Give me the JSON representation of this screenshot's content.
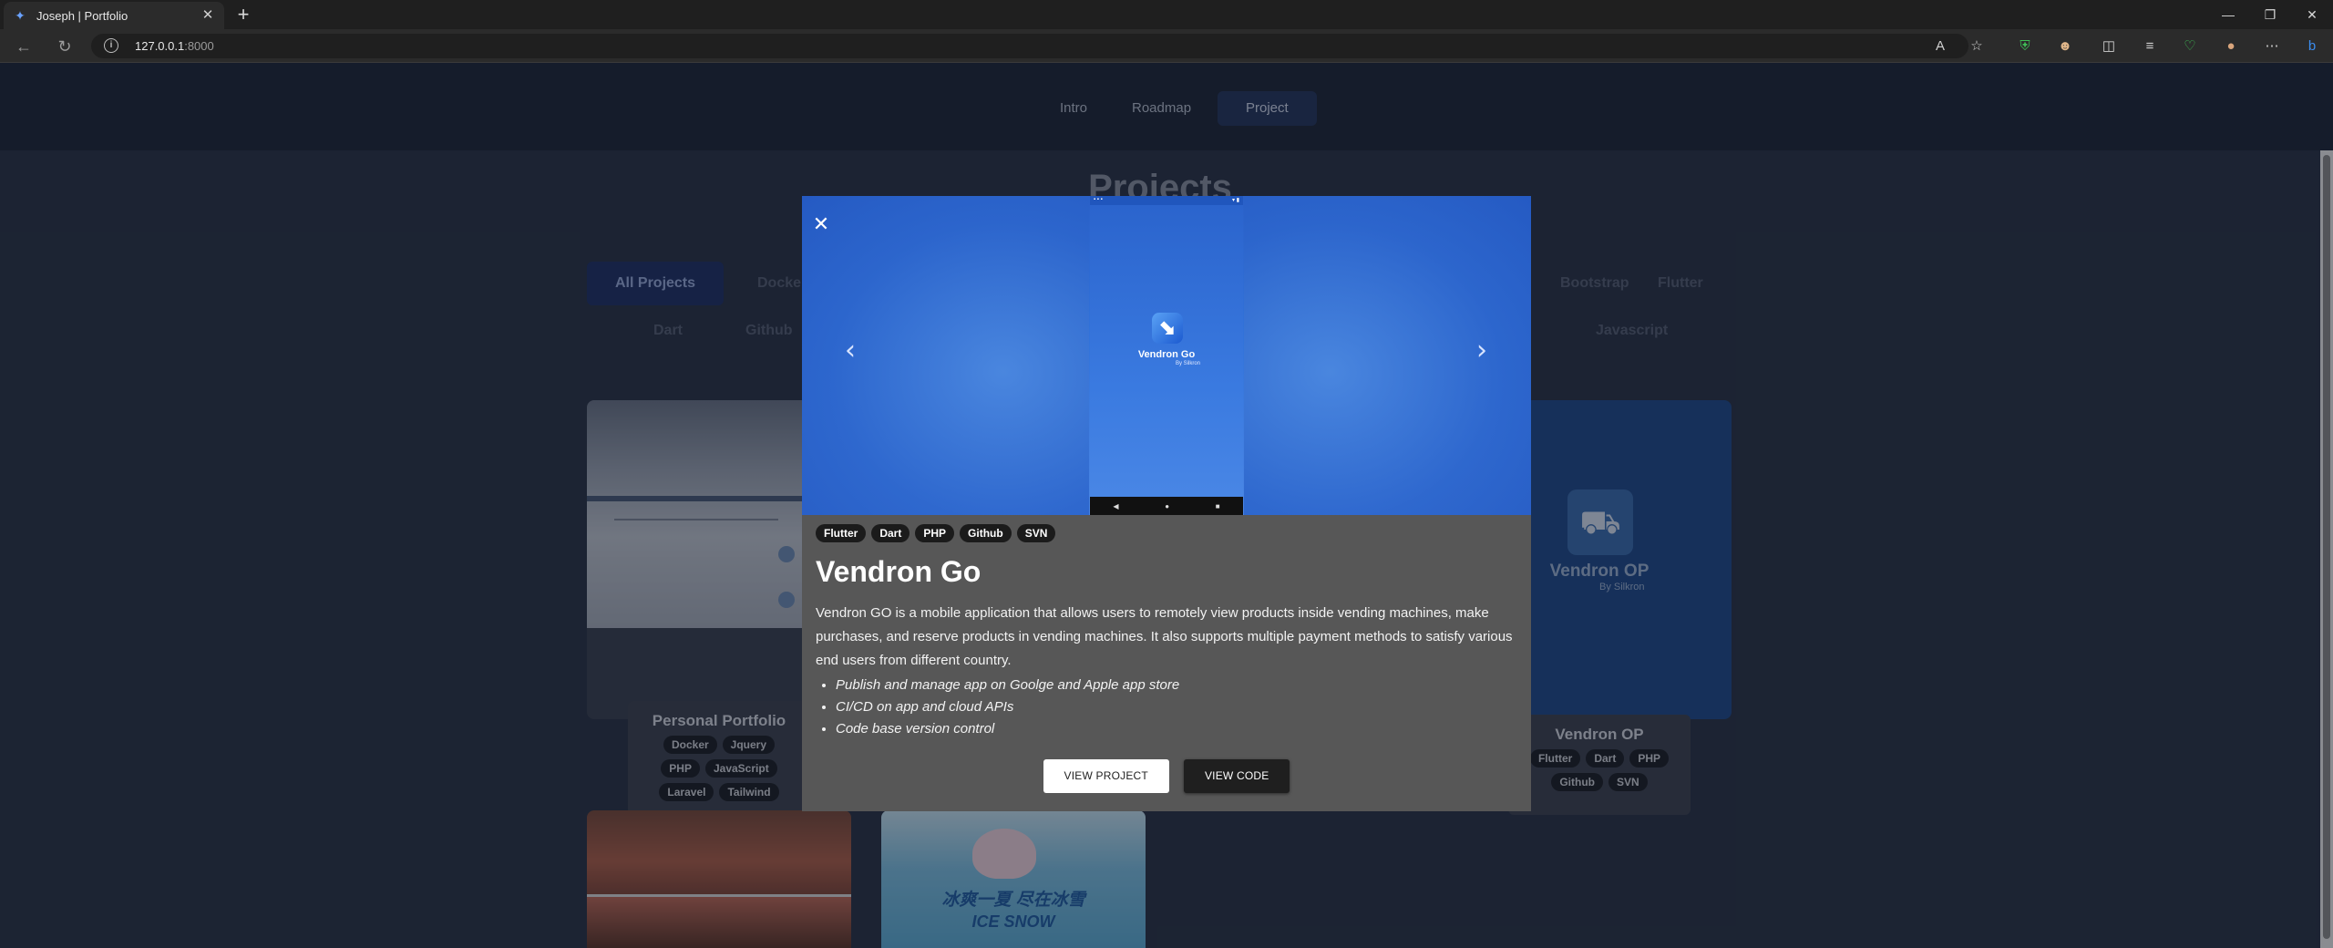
{
  "browser": {
    "tab_title": "Joseph | Portfolio",
    "url_host": "127.0.0.1",
    "url_port": ":8000",
    "favicon": "portfolio-icon"
  },
  "nav": {
    "items": [
      "Intro",
      "Roadmap",
      "Project"
    ],
    "active": "Project"
  },
  "projects": {
    "title": "Projects",
    "filters_row1": [
      "All Projects",
      "Docker",
      "Bootstrap",
      "Flutter"
    ],
    "filters_row2": [
      "Dart",
      "Github",
      "Javascript"
    ],
    "cards": [
      {
        "title": "Personal Portfolio",
        "tags": [
          "Docker",
          "Jquery",
          "PHP",
          "JavaScript",
          "Laravel",
          "Tailwind"
        ]
      },
      {
        "title": "Vendron OP",
        "logo_title": "Vendron OP",
        "logo_sub": "By Silkron",
        "tags": [
          "Flutter",
          "Dart",
          "PHP",
          "Github",
          "SVN"
        ]
      },
      {
        "title": "",
        "tags": []
      },
      {
        "title": "",
        "tags": [],
        "image_text_1": "冰爽一夏 尽在冰雪",
        "image_text_2": "ICE SNOW"
      }
    ]
  },
  "modal": {
    "tags": [
      "Flutter",
      "Dart",
      "PHP",
      "Github",
      "SVN"
    ],
    "title": "Vendron Go",
    "description": "Vendron GO is a mobile application that allows users to remotely view products inside vending machines, make purchases, and reserve products in vending machines. It also supports multiple payment methods to satisfy various end users from different country.",
    "bullets": [
      "Publish and manage app on Goolge and Apple app store",
      "CI/CD on app and cloud APIs",
      "Code base version control"
    ],
    "view_project": "VIEW PROJECT",
    "view_code": "VIEW CODE",
    "screenshot": {
      "app_name": "Vendron Go",
      "app_sub": "By Silkron"
    }
  }
}
